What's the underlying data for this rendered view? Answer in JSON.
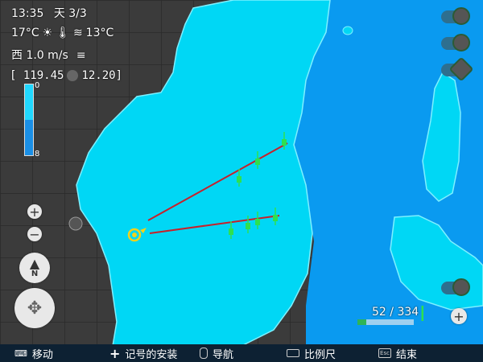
{
  "status": {
    "time": "13:35",
    "day": "天 3/3",
    "air_temp": "17°C",
    "water_temp": "13°C",
    "wind": "西 1.0 m/s",
    "coords_left": "[ 119.45",
    "coords_right": "12.20]"
  },
  "depth_scale": {
    "min_label": "0",
    "max_label": "8",
    "fill_fraction": 0.5
  },
  "catch_counter": {
    "current": "52",
    "separator": "/",
    "total": "334",
    "fraction": 0.155
  },
  "bottom_bar": {
    "move": "移动",
    "install_marker": "记号的安装",
    "navigate": "导航",
    "scale": "比例尺",
    "end": "结束",
    "esc_key": "Esc"
  },
  "controls": {
    "zoom_in": "+",
    "zoom_out": "−",
    "compass": "N",
    "add": "+"
  },
  "colors": {
    "land": "#3c3c3c",
    "shallow_water": "#00d7f5",
    "deep_water": "#0a9af0",
    "route_line": "#c8202a",
    "marker": "#2ee050",
    "boat": "#f2d21b"
  },
  "icons": [
    "sun-icon",
    "thermometer-icon",
    "water-waves-icon",
    "wind-icon",
    "anchor-icon",
    "fish-marker-icon",
    "boat-icon",
    "compass-icon",
    "dpad-icon",
    "mouse-icon",
    "esc-key-icon"
  ]
}
